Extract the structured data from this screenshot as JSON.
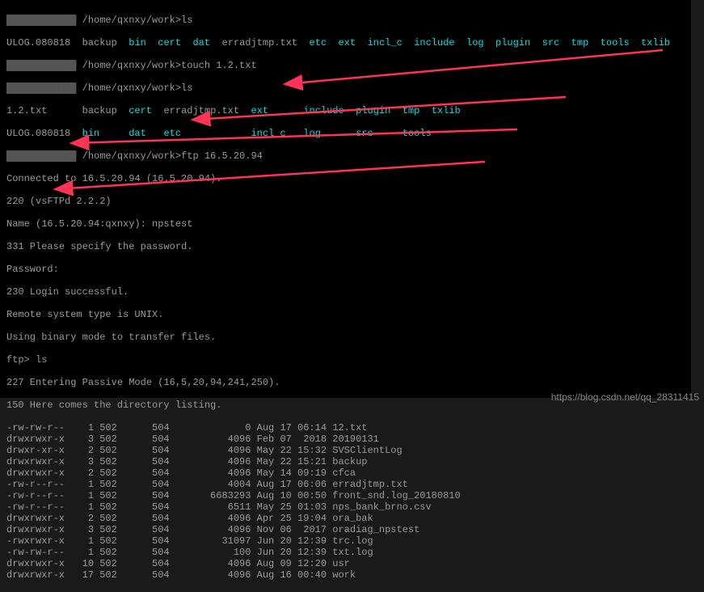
{
  "prompt_user": "████████",
  "prompt_path": "/home/qxnxy/work",
  "cmd1": "ls",
  "ls1_row1": [
    "ULOG.080818",
    "backup",
    "bin",
    "cert",
    "dat",
    "erradjtmp.txt",
    "etc",
    "ext",
    "incl_c",
    "include",
    "log",
    "plugin",
    "src",
    "tmp",
    "tools",
    "txlib"
  ],
  "ls1_dirs": [
    "bin",
    "cert",
    "dat",
    "etc",
    "ext",
    "incl_c",
    "include",
    "log",
    "plugin",
    "src",
    "tmp",
    "tools",
    "txlib"
  ],
  "cmd2": "touch 1.2.txt",
  "cmd3": "ls",
  "ls2_row1": [
    "1.2.txt",
    "",
    "backup",
    "cert",
    "erradjtmp.txt",
    "ext",
    "",
    "include",
    "plugin",
    "tmp",
    "",
    "txlib"
  ],
  "ls2_row2": [
    "ULOG.080818",
    "bin",
    "",
    "dat",
    "",
    "etc",
    "",
    "",
    "incl_c",
    "",
    "log",
    "",
    "",
    "src",
    "",
    "tools"
  ],
  "cmd4": "ftp 16.5.20.94",
  "connected": "Connected to 16.5.20.94 (16.5.20.94).",
  "ftp_banner": "220 (vsFTPd 2.2.2)",
  "name_prompt": "Name (16.5.20.94:qxnxy): npstest",
  "pass_specify": "331 Please specify the password.",
  "password": "Password:",
  "login_ok": "230 Login successful.",
  "remote_type": "Remote system type is UNIX.",
  "binary_mode": "Using binary mode to transfer files.",
  "ftp_prompt": "ftp> ",
  "ftp_cmd": "ls",
  "passive": "227 Entering Passive Mode (16,5,20,94,241,250).",
  "dir_listing": "150 Here comes the directory listing.",
  "files": [
    {
      "perm": "-rw-rw-r--",
      "links": "1",
      "uid": "502",
      "gid": "504",
      "size": "0",
      "date": "Aug 17 06:14",
      "name": "12.txt"
    },
    {
      "perm": "drwxrwxr-x",
      "links": "3",
      "uid": "502",
      "gid": "504",
      "size": "4096",
      "date": "Feb 07  2018",
      "name": "20190131"
    },
    {
      "perm": "drwxr-xr-x",
      "links": "2",
      "uid": "502",
      "gid": "504",
      "size": "4096",
      "date": "May 22 15:32",
      "name": "SVSClientLog"
    },
    {
      "perm": "drwxrwxr-x",
      "links": "3",
      "uid": "502",
      "gid": "504",
      "size": "4096",
      "date": "May 22 15:21",
      "name": "backup"
    },
    {
      "perm": "drwxrwxr-x",
      "links": "2",
      "uid": "502",
      "gid": "504",
      "size": "4096",
      "date": "May 14 09:19",
      "name": "cfca"
    },
    {
      "perm": "-rw-r--r--",
      "links": "1",
      "uid": "502",
      "gid": "504",
      "size": "4004",
      "date": "Aug 17 06:06",
      "name": "erradjtmp.txt"
    },
    {
      "perm": "-rw-r--r--",
      "links": "1",
      "uid": "502",
      "gid": "504",
      "size": "6683293",
      "date": "Aug 10 00:50",
      "name": "front_snd.log_20180810"
    },
    {
      "perm": "-rw-r--r--",
      "links": "1",
      "uid": "502",
      "gid": "504",
      "size": "6511",
      "date": "May 25 01:03",
      "name": "nps_bank_brno.csv"
    },
    {
      "perm": "drwxrwxr-x",
      "links": "2",
      "uid": "502",
      "gid": "504",
      "size": "4096",
      "date": "Apr 25 19:04",
      "name": "ora_bak"
    },
    {
      "perm": "drwxrwxr-x",
      "links": "3",
      "uid": "502",
      "gid": "504",
      "size": "4096",
      "date": "Nov 06  2017",
      "name": "oradiag_npstest"
    },
    {
      "perm": "-rwxrwxr-x",
      "links": "1",
      "uid": "502",
      "gid": "504",
      "size": "31097",
      "date": "Jun 20 12:39",
      "name": "trc.log"
    },
    {
      "perm": "-rw-rw-r--",
      "links": "1",
      "uid": "502",
      "gid": "504",
      "size": "100",
      "date": "Jun 20 12:39",
      "name": "txt.log"
    },
    {
      "perm": "drwxrwxr-x",
      "links": "10",
      "uid": "502",
      "gid": "504",
      "size": "4096",
      "date": "Aug 09 12:20",
      "name": "usr"
    },
    {
      "perm": "drwxrwxr-x",
      "links": "17",
      "uid": "502",
      "gid": "504",
      "size": "4096",
      "date": "Aug 16 00:40",
      "name": "work"
    }
  ],
  "watermark": "https://blog.csdn.net/qq_28311415"
}
